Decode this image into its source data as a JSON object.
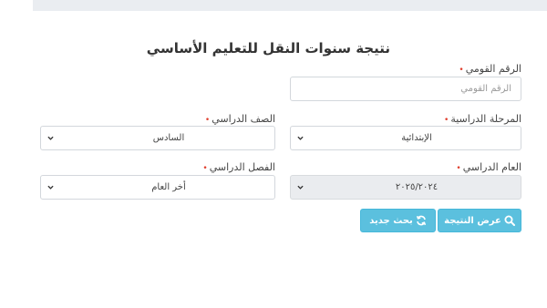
{
  "page_title": "نتيجة سنوات النقل للتعليم الأساسي",
  "required_mark": "•",
  "national_id": {
    "label": "الرقم القومي",
    "placeholder": "الرقم القومي",
    "value": ""
  },
  "stage": {
    "label": "المرحلة الدراسية",
    "value": "الإبتدائية"
  },
  "grade": {
    "label": "الصف الدراسي",
    "value": "السادس"
  },
  "year": {
    "label": "العام الدراسي",
    "value": "٢٠٢٥/٢٠٢٤"
  },
  "term": {
    "label": "الفصل الدراسي",
    "value": "أخر العام"
  },
  "buttons": {
    "show_result": "عرض النتيجة",
    "new_search": "بحث جديد"
  },
  "icons": {
    "show_result": "search-icon",
    "new_search": "refresh-icon",
    "select": "chevron-down-icon"
  },
  "colors": {
    "button": "#5bc0de",
    "required": "#e03e2d",
    "disabled_field": "#eaecef"
  }
}
